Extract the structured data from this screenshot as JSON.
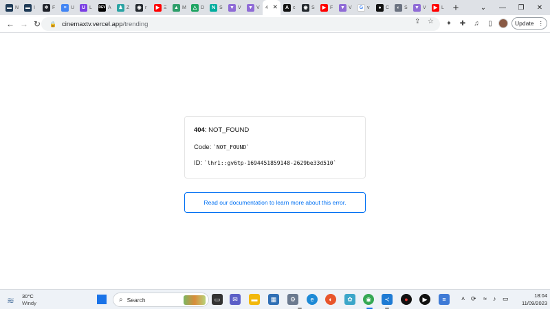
{
  "browser": {
    "tabs": [
      {
        "label": "N",
        "icon": "cinemax-favicon",
        "color": "#1f3b57",
        "glyph": "▬"
      },
      {
        "label": "I",
        "icon": "cinemax-favicon",
        "color": "#1f3b57",
        "glyph": "▬"
      },
      {
        "label": "F",
        "icon": "react-favicon",
        "color": "#20232a",
        "glyph": "⚛"
      },
      {
        "label": "U",
        "icon": "docs-favicon",
        "color": "#4285f4",
        "glyph": "≡"
      },
      {
        "label": "L",
        "icon": "purple-circle-favicon",
        "color": "#7b3fe4",
        "glyph": "U"
      },
      {
        "label": "A",
        "icon": "dev-favicon",
        "color": "#000000",
        "glyph": "DEV"
      },
      {
        "label": "Z",
        "icon": "figure-favicon",
        "color": "#2aa3a3",
        "glyph": "♟"
      },
      {
        "label": "r",
        "icon": "github-favicon",
        "color": "#24292e",
        "glyph": "◉"
      },
      {
        "label": "Ξ",
        "icon": "youtube-favicon",
        "color": "#ff0000",
        "glyph": "▶"
      },
      {
        "label": "M",
        "icon": "drop-favicon",
        "color": "#2e9e6a",
        "glyph": "▲"
      },
      {
        "label": "D",
        "icon": "drive-favicon",
        "color": "#1fa463",
        "glyph": "△"
      },
      {
        "label": "S",
        "icon": "netlify-favicon",
        "color": "#00ad9f",
        "glyph": "N"
      },
      {
        "label": "V",
        "icon": "vite-favicon",
        "color": "#8f6bd6",
        "glyph": "▼"
      },
      {
        "label": "V",
        "icon": "vite-favicon",
        "color": "#8f6bd6",
        "glyph": "▼"
      }
    ],
    "active_tab": {
      "label": "4"
    },
    "tabs_right": [
      {
        "label": "c",
        "icon": "circle-a-favicon",
        "color": "#111111",
        "glyph": "A"
      },
      {
        "label": "S",
        "icon": "github-favicon",
        "color": "#24292e",
        "glyph": "◉"
      },
      {
        "label": "F",
        "icon": "youtube-favicon",
        "color": "#ff0000",
        "glyph": "▶"
      },
      {
        "label": "V",
        "icon": "vite-favicon",
        "color": "#8f6bd6",
        "glyph": "▼"
      },
      {
        "label": "v",
        "icon": "google-favicon",
        "color": "#ffffff",
        "glyph": "G"
      },
      {
        "label": "C",
        "icon": "film-favicon",
        "color": "#111111",
        "glyph": "●"
      },
      {
        "label": "S",
        "icon": "globe-favicon",
        "color": "#6b7280",
        "glyph": "◐"
      },
      {
        "label": "V",
        "icon": "vite-favicon",
        "color": "#8f6bd6",
        "glyph": "▼"
      },
      {
        "label": "L",
        "icon": "youtube-favicon",
        "color": "#ff0000",
        "glyph": "▶"
      }
    ],
    "url_domain": "cinemaxtv.vercel.app",
    "url_path": "/trending",
    "update_label": "Update"
  },
  "error": {
    "code_number": "404",
    "code_text": ": NOT_FOUND",
    "code_label": "Code:",
    "code_value": "`NOT_FOUND`",
    "id_label": "ID:",
    "id_value": "`lhr1::gv6tp-1694451859148-2629be33d510`",
    "doc_link": "Read our documentation to learn more about this error."
  },
  "taskbar": {
    "temperature": "30°C",
    "condition": "Windy",
    "search_label": "Search",
    "time": "18:04",
    "date": "11/09/2023"
  },
  "colors": {
    "link_blue": "#0070f3",
    "tab_strip": "#dee1e6"
  }
}
